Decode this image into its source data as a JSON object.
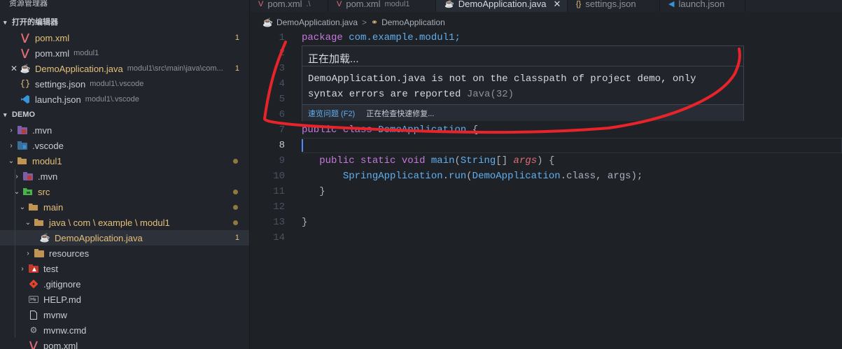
{
  "sidebar": {
    "title": "资源管理器",
    "open_editors_header": "打开的编辑器",
    "open_editors": [
      {
        "label": "pom.xml",
        "desc": "",
        "badge": "1",
        "modified": true
      },
      {
        "label": "pom.xml",
        "desc": "modul1",
        "badge": "",
        "modified": false
      },
      {
        "label": "DemoApplication.java",
        "desc": "modul1\\src\\main\\java\\com...",
        "badge": "1",
        "modified": true,
        "close": "✕"
      },
      {
        "label": "settings.json",
        "desc": "modul1\\.vscode",
        "badge": "",
        "modified": false
      },
      {
        "label": "launch.json",
        "desc": "modul1\\.vscode",
        "badge": "",
        "modified": false
      }
    ],
    "demo_header": "DEMO",
    "tree": [
      {
        "label": ".mvn"
      },
      {
        "label": ".vscode"
      },
      {
        "label": "modul1"
      },
      {
        "label": ".mvn"
      },
      {
        "label": "src"
      },
      {
        "label": "main"
      },
      {
        "label": "java \\ com \\ example \\ modul1"
      },
      {
        "label": "DemoApplication.java",
        "badge": "1"
      },
      {
        "label": "resources"
      },
      {
        "label": "test"
      },
      {
        "label": ".gitignore"
      },
      {
        "label": "HELP.md"
      },
      {
        "label": "mvnw"
      },
      {
        "label": "mvnw.cmd"
      },
      {
        "label": "pom.xml"
      }
    ]
  },
  "tabs": [
    {
      "label": "pom.xml",
      "desc": ".\\"
    },
    {
      "label": "pom.xml",
      "desc": "modul1"
    },
    {
      "label": "DemoApplication.java",
      "desc": "",
      "close": "✕"
    },
    {
      "label": "settings.json",
      "desc": ""
    },
    {
      "label": "launch.json",
      "desc": ""
    }
  ],
  "breadcrumb": {
    "file": "DemoApplication.java",
    "sep": ">",
    "symbol": "DemoApplication"
  },
  "editor": {
    "line_numbers": [
      "1",
      "2",
      "3",
      "4",
      "5",
      "6",
      "7",
      "8",
      "9",
      "10",
      "11",
      "12",
      "13",
      "14"
    ],
    "line1": {
      "kw": "package",
      "rest": "com.example.modul1;"
    },
    "line7": {
      "kw1": "public",
      "kw2": "class",
      "name": "DemoApplication",
      "brace": "{"
    },
    "line9": {
      "kw1": "public",
      "kw2": "static",
      "kw3": "void",
      "fn": "main",
      "type": "String",
      "arr": "[]",
      "param": "args",
      "tail": ") {"
    },
    "line10": {
      "cls": "SpringApplication",
      "dot": ".",
      "fn": "run",
      "arg1": "DemoApplication",
      "mid": ".class, args);"
    },
    "line11": "}",
    "line13": "}"
  },
  "hover": {
    "title": "正在加载...",
    "message": "DemoApplication.java is not on the classpath of project demo, only syntax errors are reported",
    "source": "Java(32)",
    "peek_link": "速览问题 (F2)",
    "status": "正在检查快速修复..."
  },
  "colors": {
    "annotation": "#e8232a",
    "accent": "#61afef",
    "modified": "#e5c07b"
  }
}
